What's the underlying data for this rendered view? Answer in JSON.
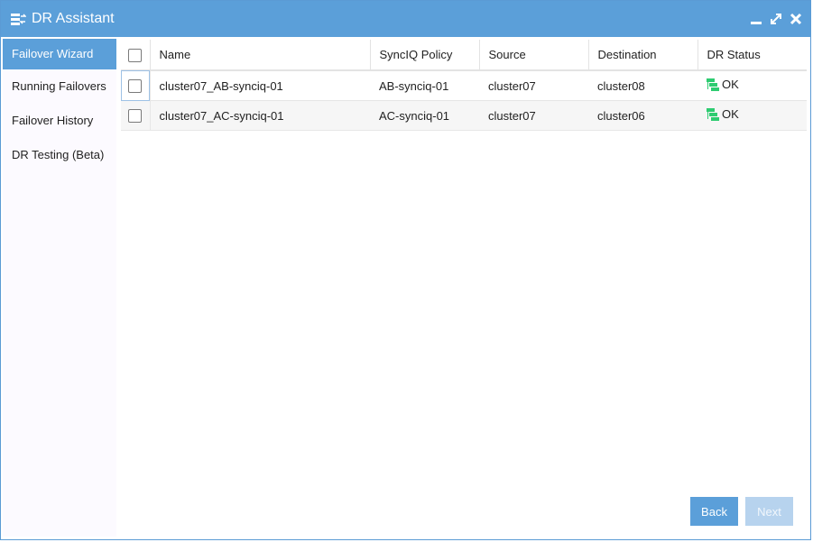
{
  "window": {
    "title": "DR Assistant"
  },
  "sidebar": {
    "items": [
      {
        "label": "Failover Wizard"
      },
      {
        "label": "Running Failovers"
      },
      {
        "label": "Failover History"
      },
      {
        "label": "DR Testing (Beta)"
      }
    ]
  },
  "table": {
    "columns": [
      "Name",
      "SyncIQ Policy",
      "Source",
      "Destination",
      "DR Status"
    ],
    "rows": [
      {
        "name": "cluster07_AB-synciq-01",
        "policy": "AB-synciq-01",
        "source": "cluster07",
        "destination": "cluster08",
        "status": "OK"
      },
      {
        "name": "cluster07_AC-synciq-01",
        "policy": "AC-synciq-01",
        "source": "cluster07",
        "destination": "cluster06",
        "status": "OK"
      }
    ]
  },
  "buttons": {
    "back": "Back",
    "next": "Next"
  },
  "colors": {
    "titlebar": "#5b9fd9",
    "status_ok": "#2ecc71",
    "next_disabled": "#b7d3ee"
  }
}
